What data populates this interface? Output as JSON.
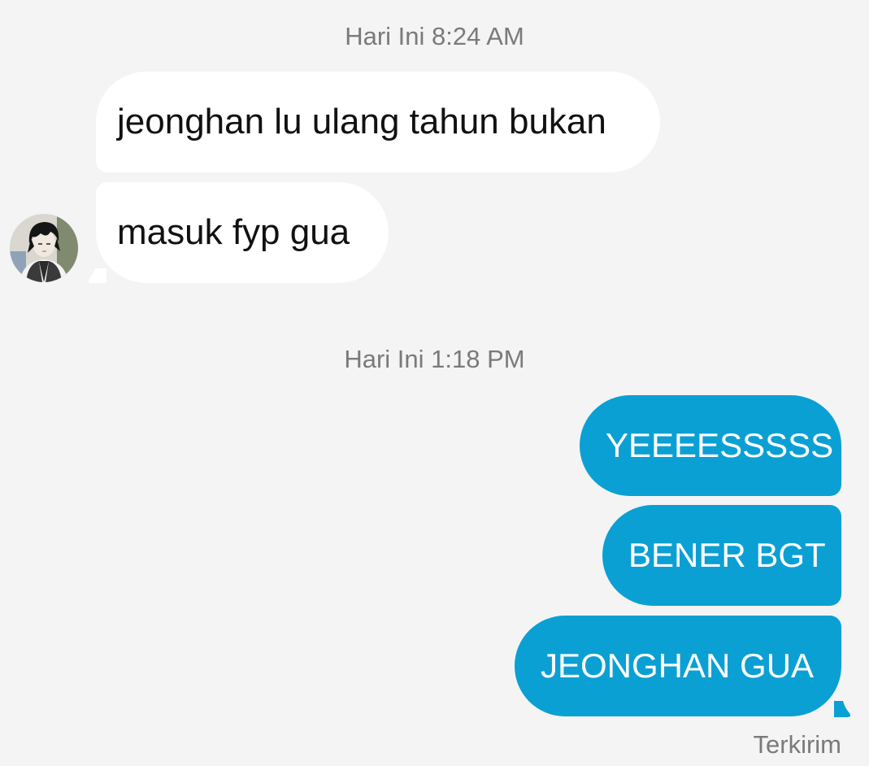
{
  "timestamps": [
    "Hari Ini 8:24 AM",
    "Hari Ini 1:18 PM"
  ],
  "incoming": [
    {
      "text": "jeonghan lu ulang tahun bukan"
    },
    {
      "text": "masuk fyp gua"
    }
  ],
  "outgoing": [
    {
      "text": "YEEEESSSSS"
    },
    {
      "text": "BENER BGT"
    },
    {
      "text": "JEONGHAN GUA"
    }
  ],
  "status": "Terkirim",
  "colors": {
    "background": "#f4f4f5",
    "incoming_bubble": "#ffffff",
    "outgoing_bubble": "#0aa0d4",
    "meta_text": "#7a7a7a"
  },
  "avatar": {
    "icon": "user-avatar-illustration"
  }
}
